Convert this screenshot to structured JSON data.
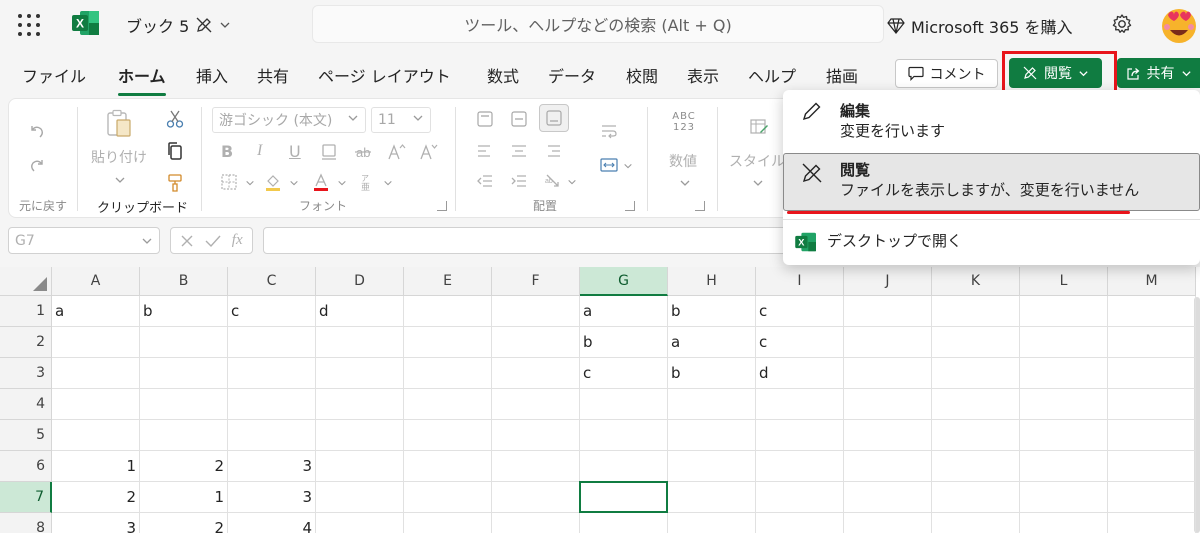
{
  "titlebar": {
    "doc_title": "ブック 5",
    "search_placeholder": "ツール、ヘルプなどの検索 (Alt + Q)",
    "buy_label": "Microsoft 365 を購入",
    "app_logo_letter": "X"
  },
  "tabs": [
    "ファイル",
    "ホーム",
    "挿入",
    "共有",
    "ページ レイアウト",
    "数式",
    "データ",
    "校閲",
    "表示",
    "ヘルプ",
    "描画"
  ],
  "active_tab": "ホーム",
  "actions": {
    "comment_label": "コメント",
    "view_label": "閲覧",
    "share_label": "共有"
  },
  "ribbon": {
    "undo_group": "元に戻す",
    "paste_label": "貼り付け",
    "clipboard_group": "クリップボード",
    "font_name": "游ゴシック (本文)",
    "font_size": "11",
    "font_group": "フォント",
    "align_group": "配置",
    "number_label": "数値",
    "number_icon_text": "ABC\n123",
    "style_label": "スタイル",
    "bold_glyph": "B",
    "italic_glyph": "I",
    "underline_glyph": "U"
  },
  "formula_bar": {
    "name_box": "G7",
    "fx_label": "fx"
  },
  "menu": {
    "items": [
      {
        "title": "編集",
        "desc": "変更を行います"
      },
      {
        "title": "閲覧",
        "desc": "ファイルを表示しますが、変更を行いません"
      },
      {
        "title": "デスクトップで開く"
      }
    ]
  },
  "sheet": {
    "columns": [
      "A",
      "B",
      "C",
      "D",
      "E",
      "F",
      "G",
      "H",
      "I",
      "J",
      "K",
      "L",
      "M"
    ],
    "rows": [
      "1",
      "2",
      "3",
      "4",
      "5",
      "6",
      "7",
      "8"
    ],
    "selected_cell": "G7",
    "cells": [
      {
        "r": 0,
        "c": 0,
        "v": "a"
      },
      {
        "r": 0,
        "c": 1,
        "v": "b"
      },
      {
        "r": 0,
        "c": 2,
        "v": "c"
      },
      {
        "r": 0,
        "c": 3,
        "v": "d"
      },
      {
        "r": 0,
        "c": 6,
        "v": "a"
      },
      {
        "r": 0,
        "c": 7,
        "v": "b"
      },
      {
        "r": 0,
        "c": 8,
        "v": "c"
      },
      {
        "r": 1,
        "c": 6,
        "v": "b"
      },
      {
        "r": 1,
        "c": 7,
        "v": "a"
      },
      {
        "r": 1,
        "c": 8,
        "v": "c"
      },
      {
        "r": 2,
        "c": 6,
        "v": "c"
      },
      {
        "r": 2,
        "c": 7,
        "v": "b"
      },
      {
        "r": 2,
        "c": 8,
        "v": "d"
      },
      {
        "r": 5,
        "c": 0,
        "v": "1",
        "num": true
      },
      {
        "r": 5,
        "c": 1,
        "v": "2",
        "num": true
      },
      {
        "r": 5,
        "c": 2,
        "v": "3",
        "num": true
      },
      {
        "r": 6,
        "c": 0,
        "v": "2",
        "num": true
      },
      {
        "r": 6,
        "c": 1,
        "v": "1",
        "num": true
      },
      {
        "r": 6,
        "c": 2,
        "v": "3",
        "num": true
      },
      {
        "r": 7,
        "c": 0,
        "v": "3",
        "num": true
      },
      {
        "r": 7,
        "c": 1,
        "v": "2",
        "num": true
      },
      {
        "r": 7,
        "c": 2,
        "v": "4",
        "num": true
      }
    ]
  },
  "colors": {
    "accent": "#107c41",
    "highlight_red": "#e8141b"
  }
}
